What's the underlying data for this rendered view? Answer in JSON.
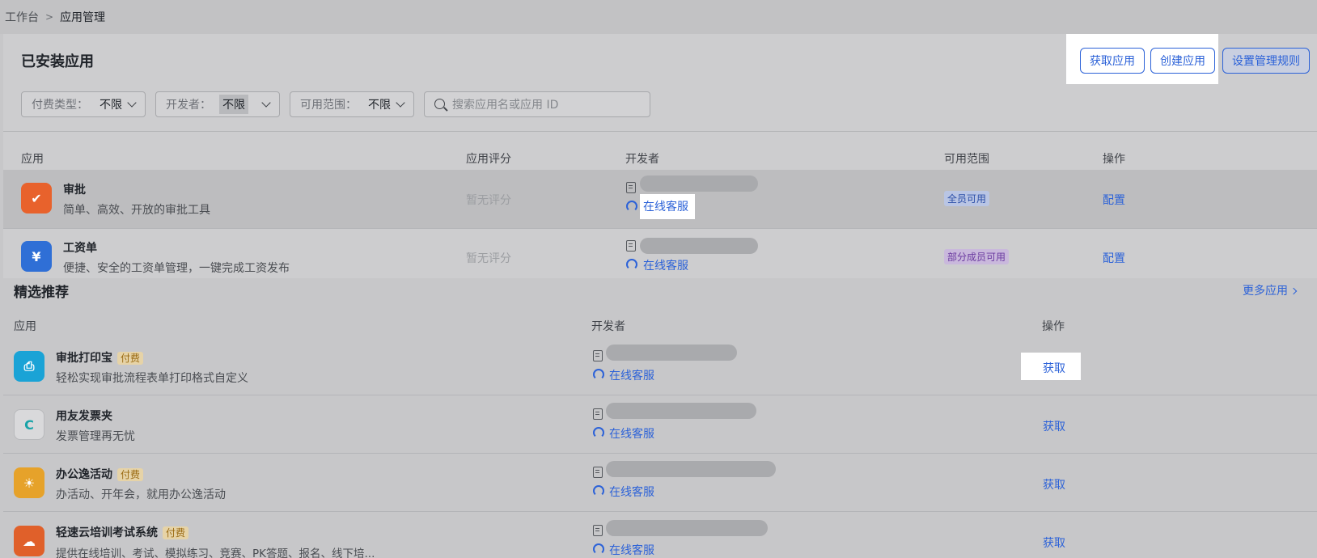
{
  "breadcrumb": {
    "home": "工作台",
    "current": "应用管理"
  },
  "installed": {
    "title": "已安装应用",
    "actions": {
      "get": "获取应用",
      "create": "创建应用",
      "rules": "设置管理规则"
    },
    "filters": [
      {
        "label": "付费类型：",
        "value": "不限"
      },
      {
        "label": "开发者：",
        "value": "不限"
      },
      {
        "label": "可用范围：",
        "value": "不限"
      }
    ],
    "search_placeholder": "搜索应用名或应用 ID",
    "columns": {
      "app": "应用",
      "rating": "应用评分",
      "developer": "开发者",
      "scope": "可用范围",
      "ops": "操作"
    },
    "rows": [
      {
        "name": "审批",
        "desc": "简单、高效、开放的审批工具",
        "rating": "暂无评分",
        "service": "在线客服",
        "scope": "全员可用",
        "op": "配置",
        "icon": "approval-icon",
        "color": "#e8622c"
      },
      {
        "name": "工资单",
        "desc": "便捷、安全的工资单管理，一键完成工资发布",
        "rating": "暂无评分",
        "service": "在线客服",
        "scope": "部分成员可用",
        "op": "配置",
        "icon": "payroll-icon",
        "color": "#2f6fd6"
      }
    ]
  },
  "featured": {
    "title": "精选推荐",
    "more": "更多应用",
    "columns": {
      "app": "应用",
      "developer": "开发者",
      "ops": "操作"
    },
    "paid_tag": "付费",
    "rows": [
      {
        "name": "审批打印宝",
        "paid": true,
        "desc": "轻松实现审批流程表单打印格式自定义",
        "service": "在线客服",
        "op": "获取",
        "icon": "printer-icon",
        "color": "#1aa3d6"
      },
      {
        "name": "用友发票夹",
        "paid": false,
        "desc": "发票管理再无忧",
        "service": "在线客服",
        "op": "获取",
        "icon": "invoice-icon",
        "color": "#d9d9db"
      },
      {
        "name": "办公逸活动",
        "paid": true,
        "desc": "办活动、开年会，就用办公逸活动",
        "service": "在线客服",
        "op": "获取",
        "icon": "bulb-icon",
        "color": "#e6a22a"
      },
      {
        "name": "轻速云培训考试系统",
        "paid": true,
        "desc": "提供在线培训、考试、模拟练习、竞赛、PK答题、报名、线下培...",
        "service": "在线客服",
        "op": "获取",
        "icon": "cloud-icon",
        "color": "#e0602a"
      }
    ]
  }
}
